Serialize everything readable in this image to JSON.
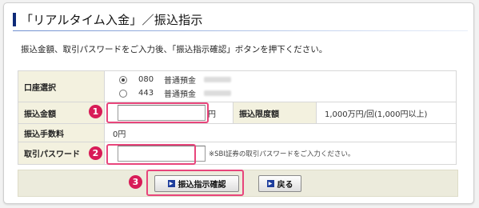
{
  "page": {
    "title": "「リアルタイム入金」／振込指示",
    "description": "振込金額、取引パスワードをご入力後、「振込指示確認」ボタンを押下ください。"
  },
  "form": {
    "account_select": {
      "label": "口座選択",
      "options": [
        {
          "branch": "080",
          "type": "普通預金",
          "selected": true
        },
        {
          "branch": "443",
          "type": "普通預金",
          "selected": false
        }
      ]
    },
    "amount": {
      "label": "振込金額",
      "value": "",
      "unit": "円",
      "step_number": "1"
    },
    "limit": {
      "label": "振込限度額",
      "value": "1,000万円/回(1,000円以上)"
    },
    "fee": {
      "label": "振込手数料",
      "value": "0円"
    },
    "password": {
      "label": "取引パスワード",
      "value": "",
      "note": "※SBI証券の取引パスワードをご入力ください。",
      "step_number": "2"
    }
  },
  "actions": {
    "confirm_label": "振込指示確認",
    "back_label": "戻る",
    "step_number": "3"
  },
  "colors": {
    "highlight": "#e8457b",
    "badge": "#d81b57",
    "label_bg": "#f3f1df",
    "accent": "#0d2a78"
  }
}
